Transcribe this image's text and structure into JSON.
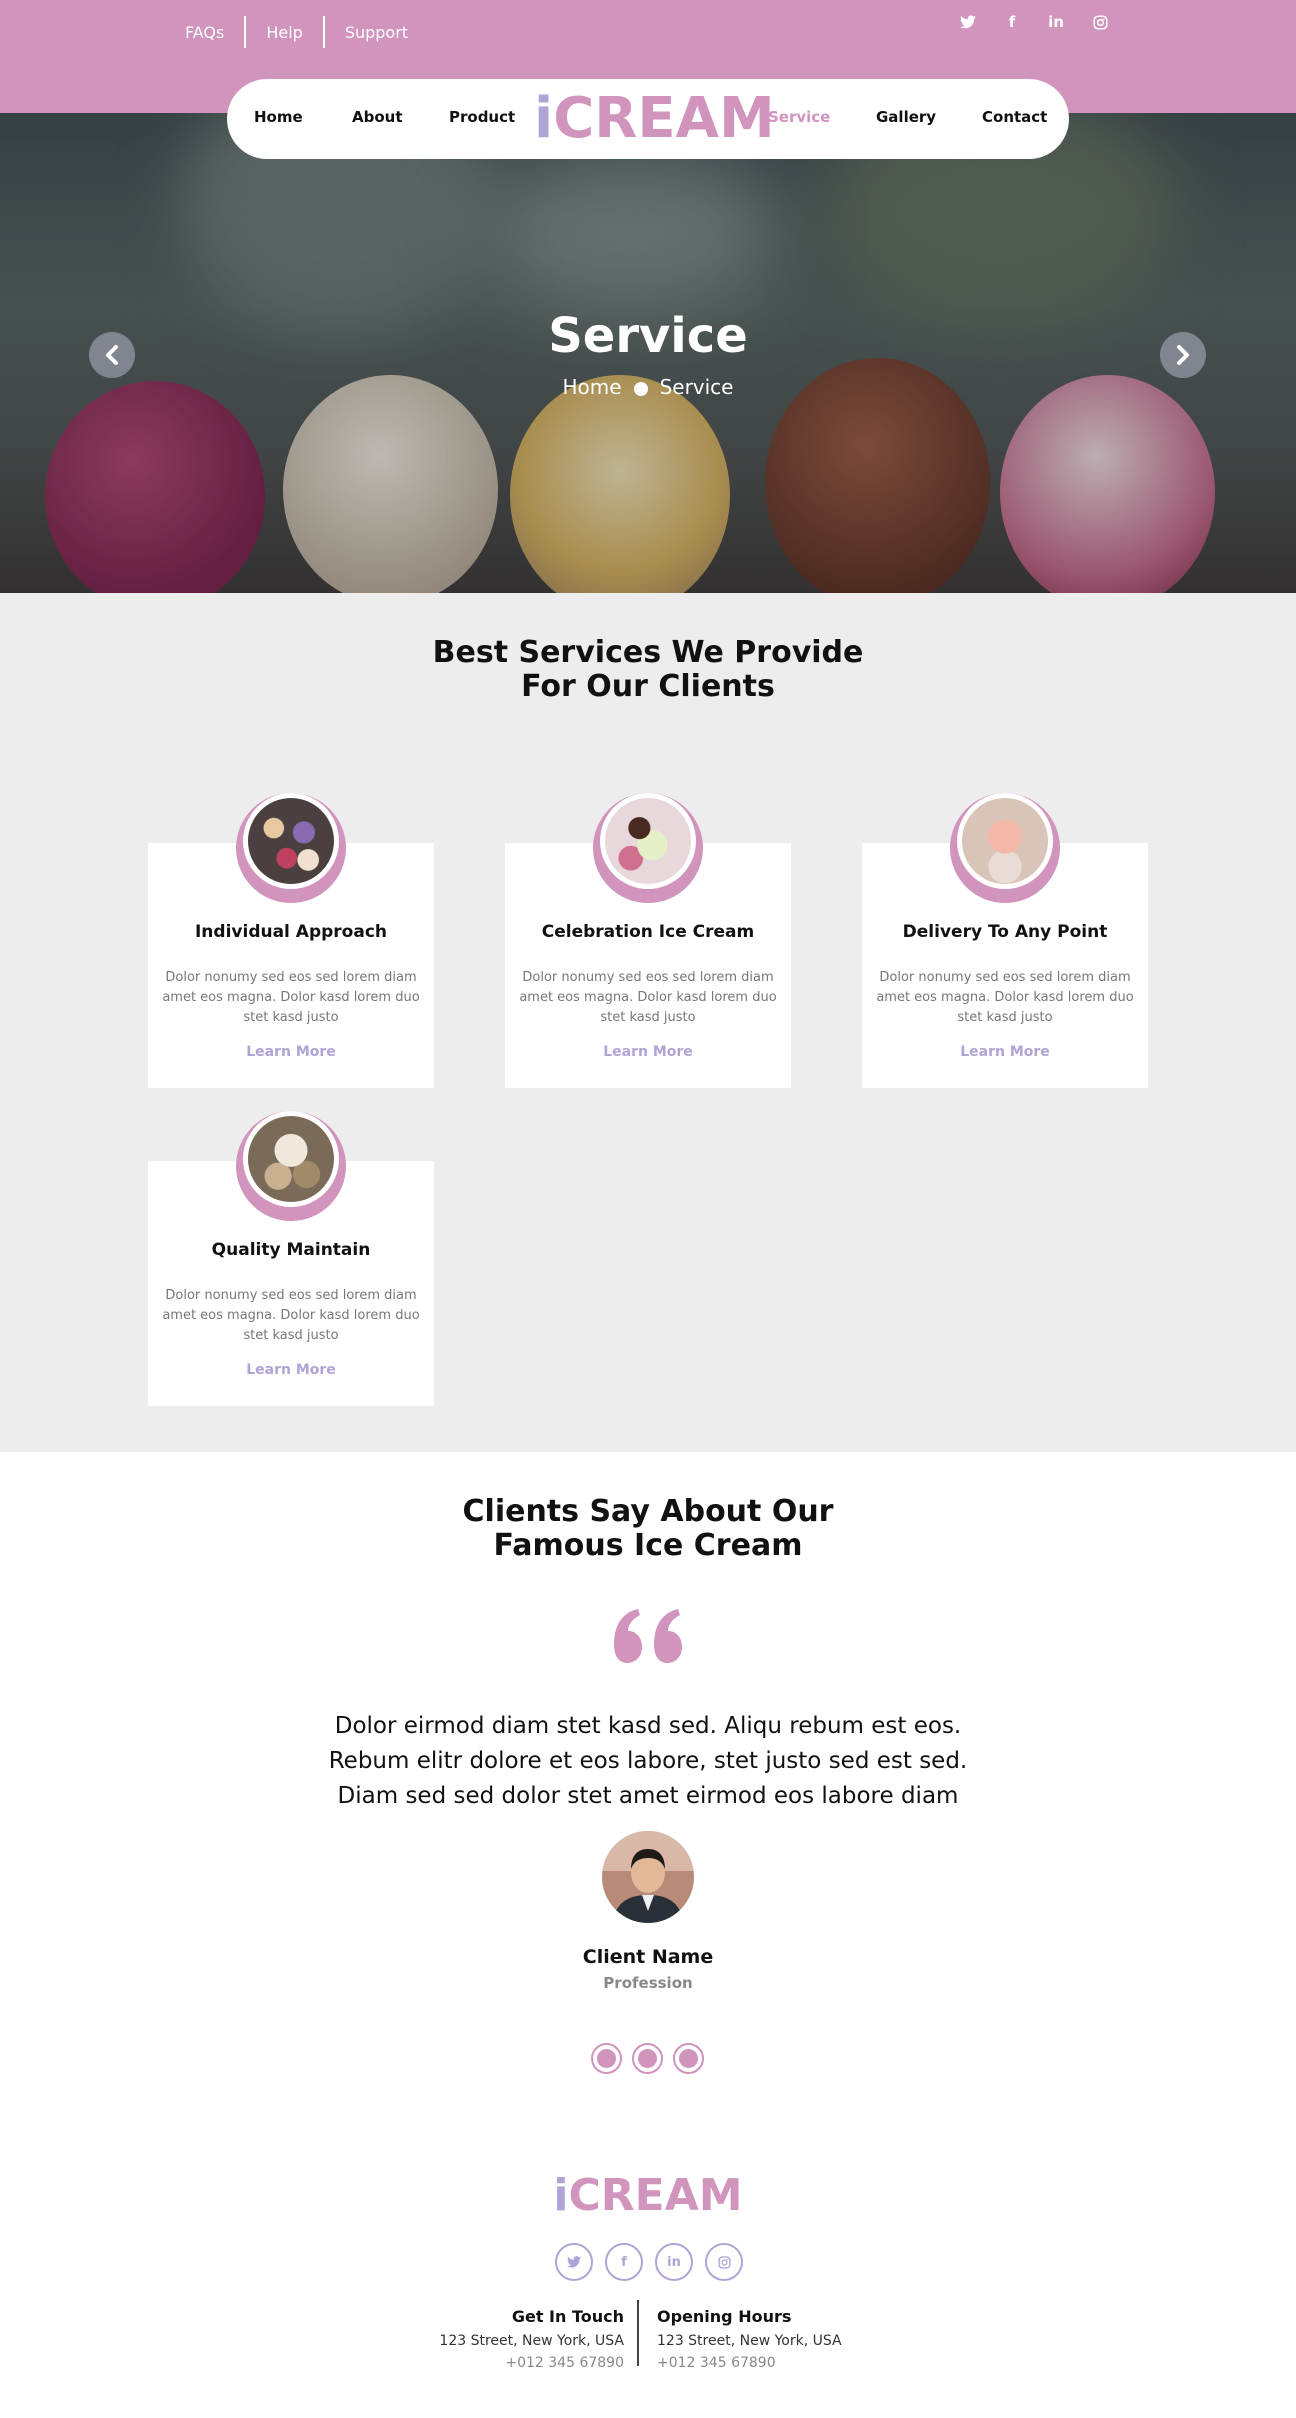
{
  "topbar": {
    "links": [
      "FAQs",
      "Help",
      "Support"
    ],
    "socials": [
      "twitter-icon",
      "facebook-icon",
      "linkedin-icon",
      "instagram-icon"
    ]
  },
  "nav": {
    "home": "Home",
    "about": "About",
    "product": "Product",
    "brand_i": "i",
    "brand_rest": "CREAM",
    "service": "Service",
    "gallery": "Gallery",
    "contact": "Contact",
    "active": "Service"
  },
  "hero": {
    "title": "Service",
    "crumb_home": "Home",
    "crumb_current": "Service",
    "prev_icon": "chevron-left-icon",
    "next_icon": "chevron-right-icon"
  },
  "services": {
    "title_line1": "Best Services We Provide",
    "title_line2": "For Our Clients",
    "cards": [
      {
        "title": "Individual Approach",
        "text": "Dolor nonumy sed eos sed lorem diam amet eos magna. Dolor kasd lorem duo stet kasd justo",
        "link": "Learn More"
      },
      {
        "title": "Celebration Ice Cream",
        "text": "Dolor nonumy sed eos sed lorem diam amet eos magna. Dolor kasd lorem duo stet kasd justo",
        "link": "Learn More"
      },
      {
        "title": "Delivery To Any Point",
        "text": "Dolor nonumy sed eos sed lorem diam amet eos magna. Dolor kasd lorem duo stet kasd justo",
        "link": "Learn More"
      },
      {
        "title": "Quality Maintain",
        "text": "Dolor nonumy sed eos sed lorem diam amet eos magna. Dolor kasd lorem duo stet kasd justo",
        "link": "Learn More"
      }
    ]
  },
  "testimonials": {
    "title_line1": "Clients Say About Our",
    "title_line2": "Famous Ice Cream",
    "quote_line1": "Dolor eirmod diam stet kasd sed. Aliqu rebum est eos.",
    "quote_line2": "Rebum elitr dolore et eos labore, stet justo sed est sed.",
    "quote_line3": "Diam sed sed dolor stet amet eirmod eos labore diam",
    "client_name": "Client Name",
    "client_profession": "Profession"
  },
  "footer": {
    "brand_i": "i",
    "brand_rest": "CREAM",
    "socials": [
      "twitter-icon",
      "facebook-icon",
      "linkedin-icon",
      "instagram-icon"
    ],
    "left_heading": "Get In Touch",
    "left_address": "123 Street, New York, USA",
    "left_phone": "+012 345 67890",
    "right_heading": "Opening Hours",
    "right_address": "123 Street, New York, USA",
    "right_phone": "+012 345 67890"
  },
  "colors": {
    "accent_pink": "#d094bd",
    "accent_lavender": "#b1a3d6",
    "section_gray": "#ededed"
  }
}
